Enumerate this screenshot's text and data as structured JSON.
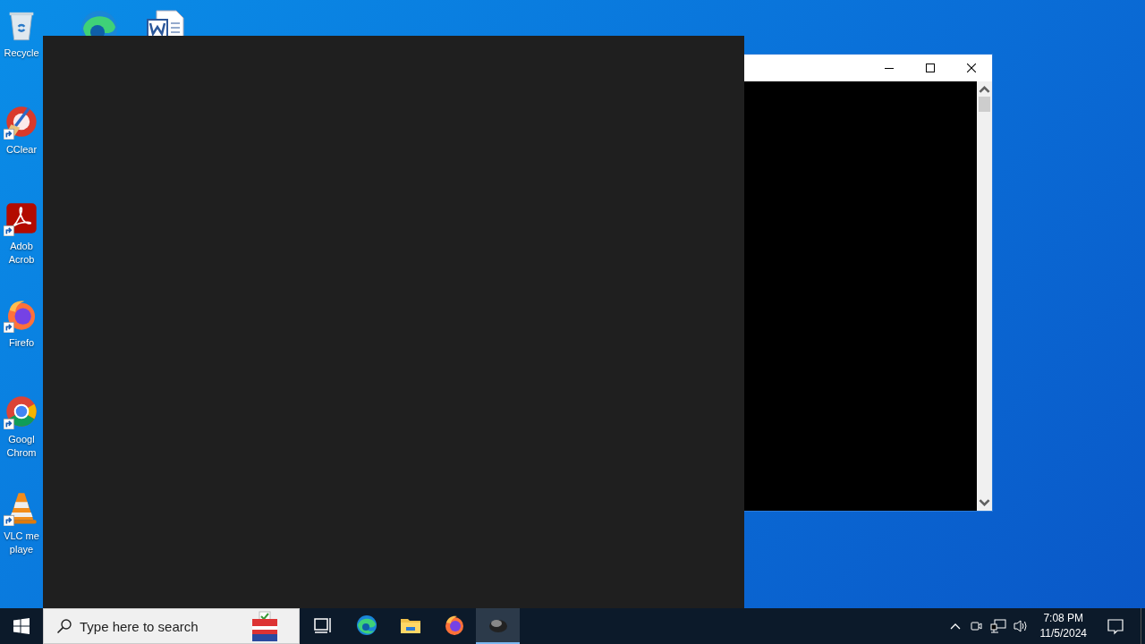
{
  "desktop_icons": [
    {
      "kind": "recycle",
      "lines": [
        "Recycle"
      ],
      "shortcut": false
    },
    {
      "kind": "ccleaner",
      "lines": [
        "CClear"
      ],
      "shortcut": true
    },
    {
      "kind": "acrobat",
      "lines": [
        "Adob",
        "Acrob"
      ],
      "shortcut": true
    },
    {
      "kind": "firefox",
      "lines": [
        "Firefo"
      ],
      "shortcut": true
    },
    {
      "kind": "chrome",
      "lines": [
        "Googl",
        "Chrom"
      ],
      "shortcut": true
    },
    {
      "kind": "vlc",
      "lines": [
        "VLC me",
        "playe"
      ],
      "shortcut": true
    },
    {
      "kind": "edge",
      "shortcut": false
    },
    {
      "kind": "word",
      "shortcut": false
    }
  ],
  "console_window": {
    "buttons": [
      {
        "kind": "minimize"
      },
      {
        "kind": "maximize"
      },
      {
        "kind": "close"
      }
    ]
  },
  "taskbar": {
    "search": {
      "placeholder": "Type here to search"
    },
    "apps": [
      {
        "kind": "taskview",
        "selected": false
      },
      {
        "kind": "edge",
        "selected": false
      },
      {
        "kind": "explorer",
        "selected": false
      },
      {
        "kind": "firefox",
        "selected": false
      },
      {
        "kind": "app",
        "selected": true
      }
    ],
    "tray": {
      "time": "7:08 PM",
      "date": "11/5/2024"
    }
  }
}
